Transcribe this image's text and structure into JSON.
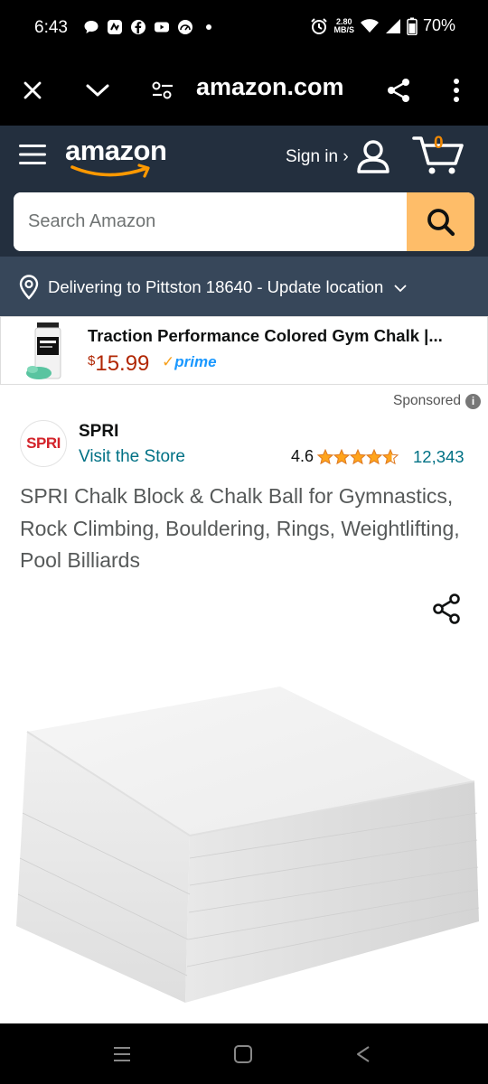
{
  "status_bar": {
    "time": "6:43",
    "net_speed_value": "2.80",
    "net_speed_unit": "MB/S",
    "battery": "70%",
    "icons": [
      "chat-icon",
      "app-icon",
      "facebook-icon",
      "youtube-icon",
      "speedometer-icon",
      "dot-icon",
      "alarm-icon",
      "wifi-icon",
      "signal-icon",
      "battery-icon"
    ]
  },
  "browser": {
    "url": "amazon.com",
    "icons": [
      "close-icon",
      "chevron-down-icon",
      "site-settings-icon",
      "share-icon",
      "more-vert-icon"
    ]
  },
  "header": {
    "logo_text": "amazon",
    "sign_in": "Sign in ›",
    "cart_count": "0",
    "search_placeholder": "Search Amazon",
    "accent_color": "#febd69",
    "bg_color": "#232f3e"
  },
  "location": {
    "text": "Delivering to Pittston 18640 - Update location"
  },
  "sponsored_product": {
    "title": "Traction Performance Colored Gym Chalk |...",
    "price_currency": "$",
    "price": "15.99",
    "prime_label": "prime"
  },
  "sponsored_label": "Sponsored",
  "product": {
    "brand_logo_text": "SPRI",
    "brand": "SPRI",
    "visit_store": "Visit the Store",
    "rating": "4.6",
    "rating_stars": 4.6,
    "review_count": "12,343",
    "title": "SPRI Chalk Block & Chalk Ball for Gymnastics, Rock Climbing, Bouldering, Rings, Weightlifting, Pool Billiards"
  },
  "nav": {
    "icons": [
      "recent-apps-icon",
      "home-icon",
      "back-icon"
    ]
  }
}
